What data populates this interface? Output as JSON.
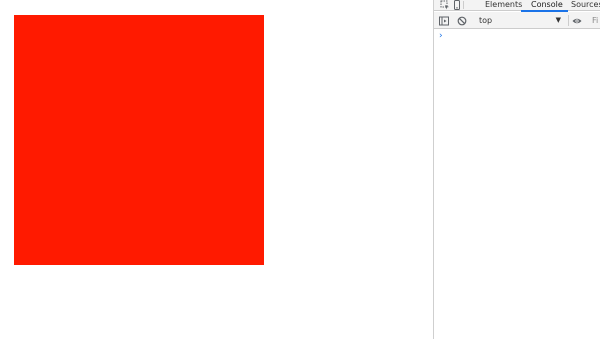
{
  "page": {
    "square_color": "#ff1a00"
  },
  "devtools": {
    "tabs": [
      {
        "label": "Elements",
        "active": false
      },
      {
        "label": "Console",
        "active": true
      },
      {
        "label": "Sources",
        "active": false
      }
    ],
    "accent_color": "#1a73e8",
    "toolbar": {
      "context_value": "top",
      "filter_placeholder": "Fi"
    },
    "console": {
      "prompt_symbol": "›"
    },
    "icons": {
      "inspect": "inspect-element-icon",
      "device": "device-toolbar-icon",
      "sidebar": "show-sidebar-icon",
      "clear": "clear-console-icon",
      "live_expression": "eye-icon"
    }
  }
}
